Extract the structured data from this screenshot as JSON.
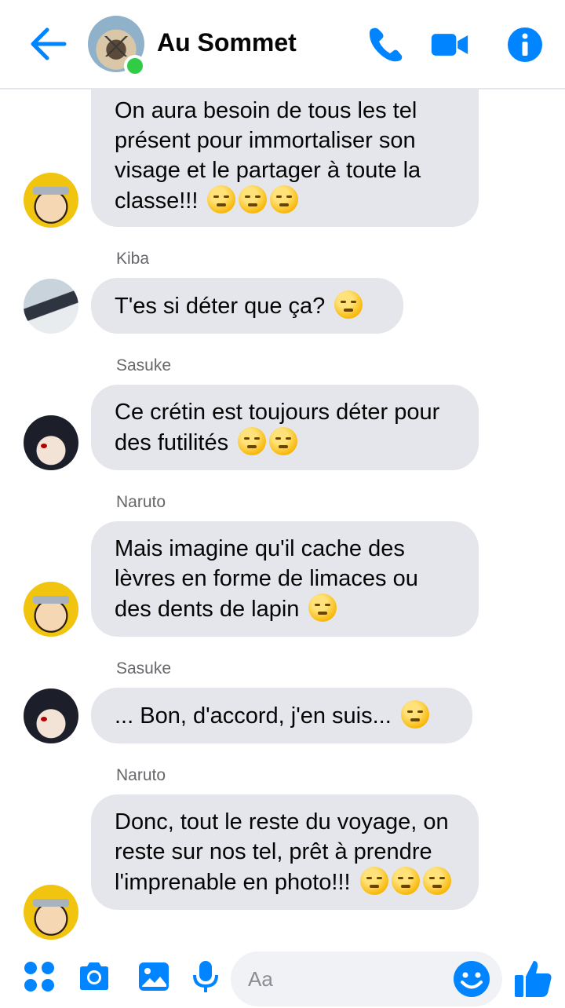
{
  "header": {
    "title": "Au Sommet"
  },
  "colors": {
    "accent": "#0084ff",
    "online": "#31cc46",
    "bubble": "#e4e6eb"
  },
  "messages": [
    {
      "sender": "",
      "text": "On aura besoin de tous les tel présent pour immortaliser son visage et le partager à toute la classe!!!",
      "emoji_count": 3
    },
    {
      "sender": "Kiba",
      "text": "T'es si déter que ça?",
      "emoji_count": 1
    },
    {
      "sender": "Sasuke",
      "text": "Ce crétin est toujours déter pour des futilités",
      "emoji_count": 2
    },
    {
      "sender": "Naruto",
      "text": "Mais imagine qu'il cache des lèvres en forme de limaces ou des dents de lapin",
      "emoji_count": 1
    },
    {
      "sender": "Sasuke",
      "text": "... Bon, d'accord, j'en suis...",
      "emoji_count": 1
    },
    {
      "sender": "Naruto",
      "text": "Donc, tout le reste du voyage, on reste sur nos tel, prêt à prendre l'imprenable en photo!!!",
      "emoji_count": 3
    }
  ],
  "composer": {
    "placeholder": "Aa"
  },
  "icons": [
    "back-arrow-icon",
    "phone-icon",
    "video-camera-icon",
    "info-icon",
    "menu-grid-icon",
    "camera-icon",
    "gallery-icon",
    "microphone-icon",
    "emoji-icon",
    "thumbs-up-icon"
  ]
}
